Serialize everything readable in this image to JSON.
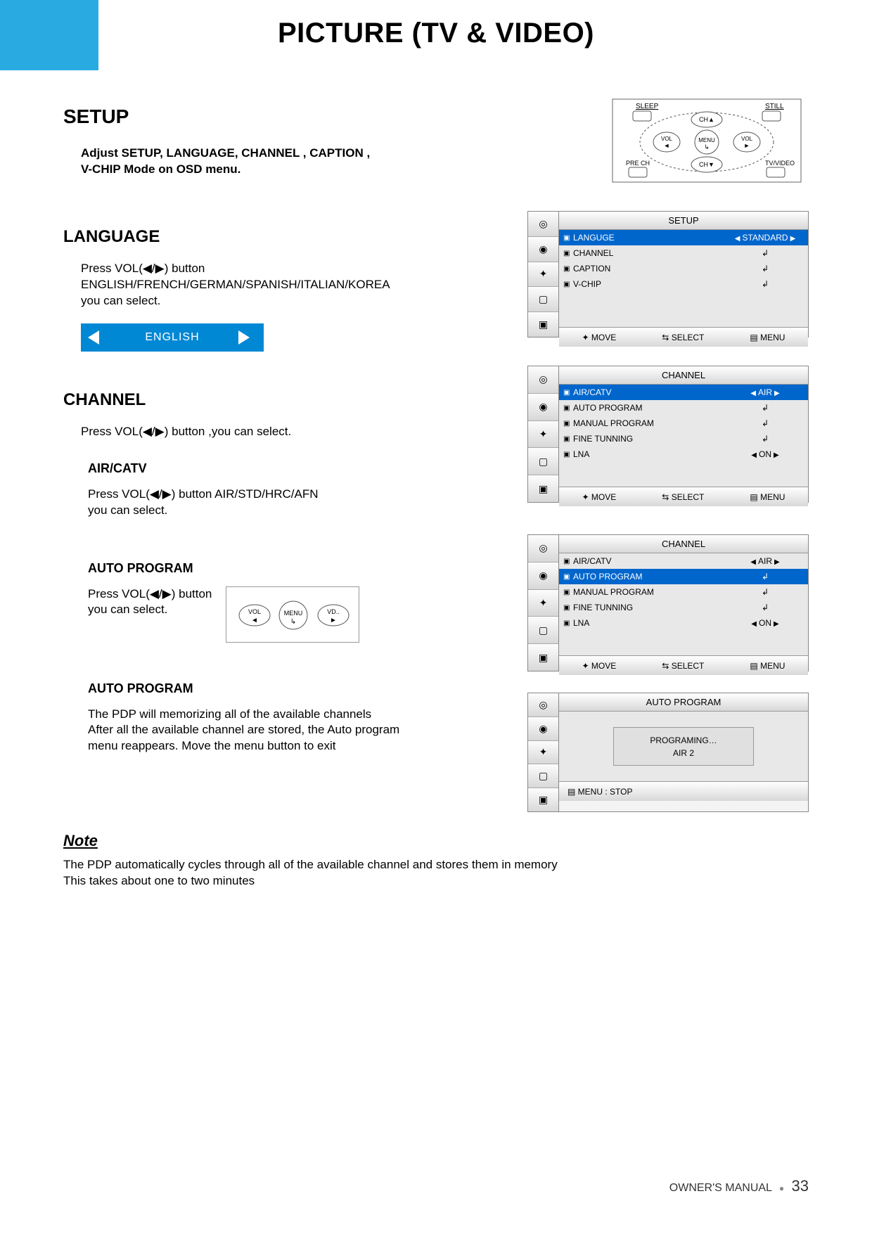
{
  "page_title": "PICTURE (TV & VIDEO)",
  "setup": {
    "heading": "SETUP",
    "body": "Adjust SETUP, LANGUAGE, CHANNEL , CAPTION , V-CHIP Mode on OSD menu."
  },
  "remote": {
    "sleep": "SLEEP",
    "still": "STILL",
    "ch_up": "CH▲",
    "ch_dn": "CH▼",
    "vol_l": "VOL",
    "vol_r": "VOL",
    "menu": "MENU",
    "pre_ch": "PRE CH",
    "tv_video": "TV/VIDEO"
  },
  "language": {
    "heading": "LANGUAGE",
    "body_1": "Press  VOL(◀/▶) button",
    "body_2": "ENGLISH/FRENCH/GERMAN/SPANISH/ITALIAN/KOREA",
    "body_3": "you can select.",
    "selector_value": "ENGLISH"
  },
  "channel": {
    "heading": "CHANNEL",
    "body": "Press  VOL(◀/▶) button ,you can select.",
    "air_catv": {
      "heading": "AIR/CATV",
      "body_1": "Press  VOL(◀/▶) button AIR/STD/HRC/AFN",
      "body_2": "you can select."
    },
    "auto_program_1": {
      "heading": "AUTO PROGRAM",
      "body_1": "Press  VOL(◀/▶) button",
      "body_2": "you can select."
    },
    "mini_remote": {
      "vol": "VOL",
      "menu": "MENU",
      "vd": "VD.."
    },
    "auto_program_2": {
      "heading": "AUTO PROGRAM",
      "body_1": "The PDP will memorizing all of the available channels",
      "body_2": "After all the available channel are stored, the Auto program",
      "body_3": "menu reappears. Move the menu button to exit"
    }
  },
  "osd_setup": {
    "title": "SETUP",
    "rows": [
      {
        "k": "LANGUGE",
        "v": "STANDARD",
        "sel": true,
        "arrows": true
      },
      {
        "k": "CHANNEL",
        "enter": true
      },
      {
        "k": "CAPTION",
        "enter": true
      },
      {
        "k": "V-CHIP",
        "enter": true
      }
    ],
    "footer": {
      "move": "MOVE",
      "select": "SELECT",
      "menu": "MENU"
    }
  },
  "osd_channel_1": {
    "title": "CHANNEL",
    "rows": [
      {
        "k": "AIR/CATV",
        "v": "AIR",
        "sel": true,
        "arrows": true
      },
      {
        "k": "AUTO PROGRAM",
        "enter": true
      },
      {
        "k": "MANUAL PROGRAM",
        "enter": true
      },
      {
        "k": "FINE TUNNING",
        "enter": true
      },
      {
        "k": "LNA",
        "v": "ON",
        "arrows": true
      }
    ],
    "footer": {
      "move": "MOVE",
      "select": "SELECT",
      "menu": "MENU"
    }
  },
  "osd_channel_2": {
    "title": "CHANNEL",
    "rows": [
      {
        "k": "AIR/CATV",
        "v": "AIR",
        "arrows": true
      },
      {
        "k": "AUTO PROGRAM",
        "sel": true,
        "enter": true
      },
      {
        "k": "MANUAL PROGRAM",
        "enter": true
      },
      {
        "k": "FINE TUNNING",
        "enter": true
      },
      {
        "k": "LNA",
        "v": "ON",
        "arrows": true
      }
    ],
    "footer": {
      "move": "MOVE",
      "select": "SELECT",
      "menu": "MENU"
    }
  },
  "osd_auto": {
    "title": "AUTO PROGRAM",
    "line1": "PROGRAMING…",
    "line2": "AIR   2",
    "footer_menu": "MENU : STOP"
  },
  "note": {
    "heading": "Note",
    "body_1": "The PDP automatically cycles through all of the available channel and stores them in memory",
    "body_2": "This takes about one to two minutes"
  },
  "footer": {
    "label": "OWNER'S MANUAL",
    "page": "33"
  }
}
